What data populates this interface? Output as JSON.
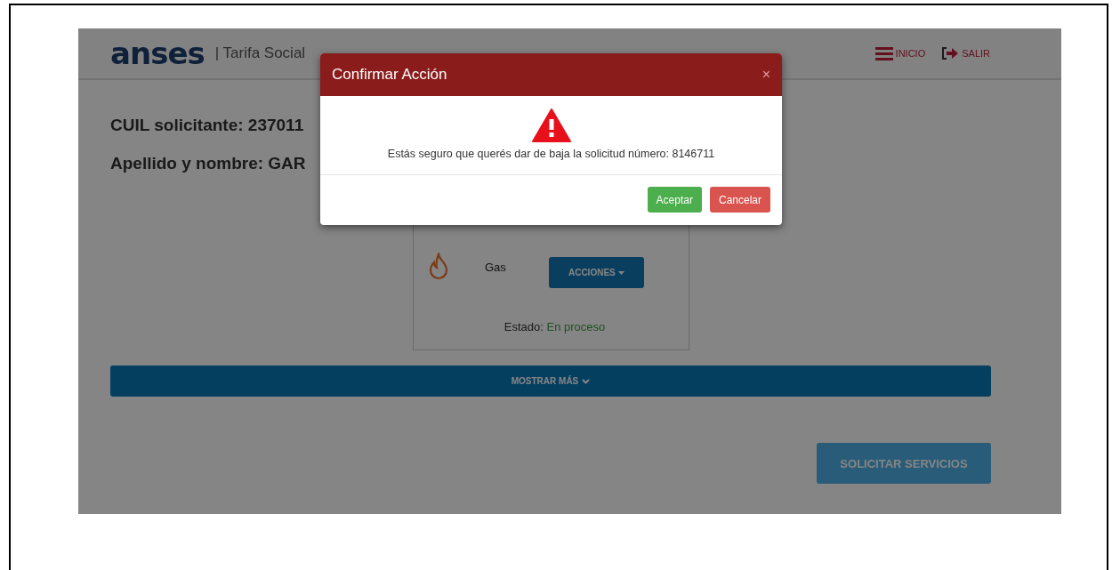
{
  "header": {
    "logo": "anses",
    "product": "| Tarifa Social",
    "nav": [
      {
        "kind": "menu",
        "label": "INICIO"
      },
      {
        "kind": "exit",
        "label": "SALIR"
      }
    ]
  },
  "applicant": {
    "cuil": "CUIL solicitante: 237011",
    "name": "Apellido y nombre: GAR"
  },
  "service_card": {
    "service": "Gas",
    "actions_button": "ACCIONES",
    "status_label": "Estado:",
    "status_value": "En proceso"
  },
  "show_more": "MOSTRAR MÁS",
  "request_button": "SOLICITAR SERVICIOS",
  "dialog": {
    "title": "Confirmar Acción",
    "close": "×",
    "message": "Estás seguro que querés dar de baja la solicitud número: 8146711",
    "buttons": [
      {
        "kind": "success",
        "label": "Aceptar"
      },
      {
        "kind": "danger",
        "label": "Cancelar"
      }
    ]
  }
}
